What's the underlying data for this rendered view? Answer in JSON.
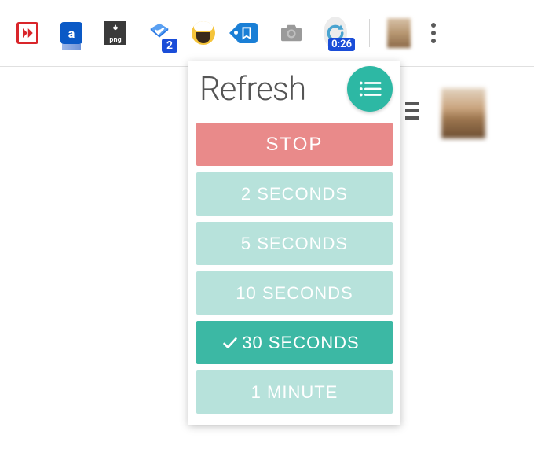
{
  "toolbar": {
    "inbox_badge": "2",
    "png_label": "png",
    "amazon_letter": "a",
    "refresh_timer": "0:26"
  },
  "popover": {
    "title": "Refresh",
    "stop_label": "STOP",
    "options": [
      {
        "label": "2 SECONDS",
        "selected": false
      },
      {
        "label": "5 SECONDS",
        "selected": false
      },
      {
        "label": "10 SECONDS",
        "selected": false
      },
      {
        "label": "30 SECONDS",
        "selected": true
      },
      {
        "label": "1 MINUTE",
        "selected": false
      }
    ]
  }
}
